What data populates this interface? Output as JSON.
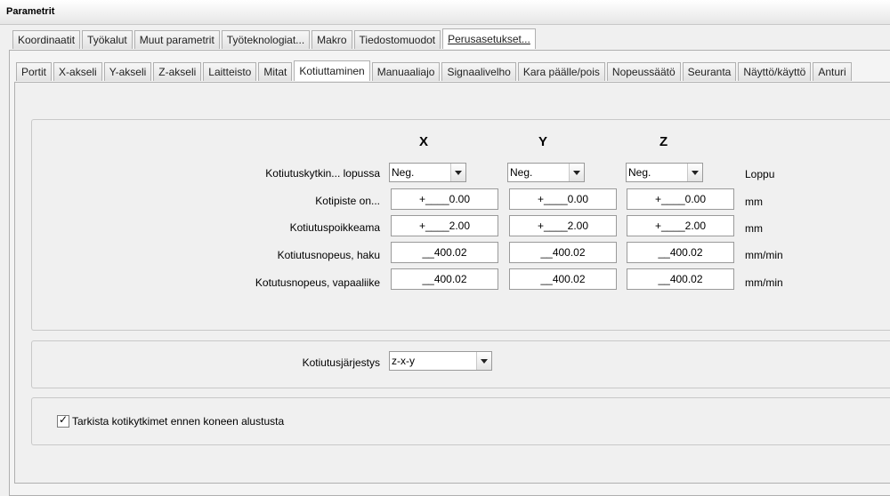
{
  "window": {
    "title": "Parametrit"
  },
  "main_tabs": [
    "Koordinaatit",
    "Työkalut",
    "Muut parametrit",
    "Työteknologiat...",
    "Makro",
    "Tiedostomuodot",
    "Perusasetukset..."
  ],
  "main_active": "Perusasetukset...",
  "sub_tabs": [
    "Portit",
    "X-akseli",
    "Y-akseli",
    "Z-akseli",
    "Laitteisto",
    "Mitat",
    "Kotiuttaminen",
    "Manuaaliajo",
    "Signaalivelho",
    "Kara päälle/pois",
    "Nopeussäätö",
    "Seuranta",
    "Näyttö/käyttö",
    "Anturi"
  ],
  "sub_active": "Kotiuttaminen",
  "axes": {
    "x": "X",
    "y": "Y",
    "z": "Z"
  },
  "rows": {
    "switch": {
      "label": "Kotiutuskytkin... lopussa",
      "x": "Neg.",
      "y": "Neg.",
      "z": "Neg.",
      "unit": "Loppu"
    },
    "point": {
      "label": "Kotipiste on...",
      "x": "+____0.00",
      "y": "+____0.00",
      "z": "+____0.00",
      "unit": "mm"
    },
    "offset": {
      "label": "Kotiutuspoikkeama",
      "x": "+____2.00",
      "y": "+____2.00",
      "z": "+____2.00",
      "unit": "mm"
    },
    "speed_search": {
      "label": "Kotiutusnopeus, haku",
      "x": "__400.02",
      "y": "__400.02",
      "z": "__400.02",
      "unit": "mm/min"
    },
    "speed_release": {
      "label": "Kotutusnopeus, vapaaliike",
      "x": "__400.02",
      "y": "__400.02",
      "z": "__400.02",
      "unit": "mm/min"
    }
  },
  "order": {
    "label": "Kotiutusjärjestys",
    "value": "z-x-y"
  },
  "check": {
    "label": "Tarkista kotikytkimet ennen koneen alustusta",
    "checked": true
  }
}
